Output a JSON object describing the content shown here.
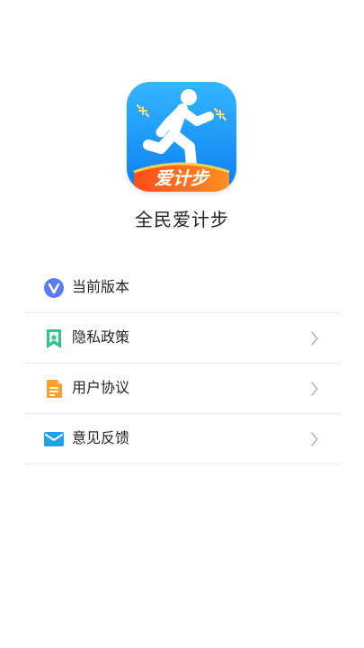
{
  "app": {
    "logo_text": "爱计步",
    "name": "全民爱计步"
  },
  "menu": {
    "items": [
      {
        "label": "当前版本",
        "icon": "version-v-icon",
        "has_chevron": false
      },
      {
        "label": "隐私政策",
        "icon": "privacy-bookmark-icon",
        "has_chevron": true
      },
      {
        "label": "用户协议",
        "icon": "document-icon",
        "has_chevron": true
      },
      {
        "label": "意见反馈",
        "icon": "mail-icon",
        "has_chevron": true
      }
    ]
  },
  "colors": {
    "logo_blue": "#1e9bff",
    "logo_orange": "#ff6a1a",
    "version_icon": "#5b7cf5",
    "privacy_icon": "#2fc38d",
    "document_icon": "#f7a02c",
    "mail_icon": "#1aa3ea",
    "divider": "#e8e8e8",
    "chevron": "#b5b5b5"
  }
}
